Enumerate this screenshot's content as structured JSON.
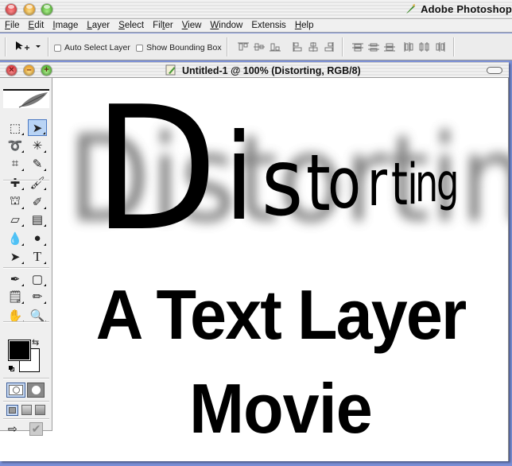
{
  "app": {
    "title": "Adobe Photoshop",
    "icon": "photoshop-feather-icon"
  },
  "menubar": {
    "items": [
      {
        "label": "File",
        "mnemonic": "F"
      },
      {
        "label": "Edit",
        "mnemonic": "E"
      },
      {
        "label": "Image",
        "mnemonic": "I"
      },
      {
        "label": "Layer",
        "mnemonic": "L"
      },
      {
        "label": "Select",
        "mnemonic": "S"
      },
      {
        "label": "Filter",
        "mnemonic": "t"
      },
      {
        "label": "View",
        "mnemonic": "V"
      },
      {
        "label": "Window",
        "mnemonic": "W"
      },
      {
        "label": "Extensis",
        "mnemonic": ""
      },
      {
        "label": "Help",
        "mnemonic": "H"
      }
    ]
  },
  "options": {
    "tool_preset_icon": "move-tool-icon",
    "auto_select_label": "Auto Select Layer",
    "auto_select_checked": false,
    "bounding_box_label": "Show Bounding Box",
    "bounding_box_checked": false,
    "align_buttons": [
      "align-top-edges",
      "align-vertical-centers",
      "align-bottom-edges",
      "align-left-edges",
      "align-horizontal-centers",
      "align-right-edges"
    ],
    "distribute_buttons": [
      "distribute-top-edges",
      "distribute-vertical-centers",
      "distribute-bottom-edges",
      "distribute-left-edges",
      "distribute-horizontal-centers",
      "distribute-right-edges"
    ]
  },
  "document": {
    "title": "Untitled-1 @ 100% (Distorting, RGB/8)"
  },
  "tools": {
    "items": [
      {
        "name": "rectangular-marquee-tool",
        "glyph": "⬚",
        "active": false
      },
      {
        "name": "move-tool",
        "glyph": "➤",
        "active": true
      },
      {
        "name": "lasso-tool",
        "glyph": "➰",
        "active": false
      },
      {
        "name": "magic-wand-tool",
        "glyph": "✳",
        "active": false
      },
      {
        "name": "crop-tool",
        "glyph": "⌗",
        "active": false
      },
      {
        "name": "slice-tool",
        "glyph": "✎",
        "active": false
      },
      {
        "name": "healing-brush-tool",
        "glyph": "✚",
        "active": false
      },
      {
        "name": "brush-tool",
        "glyph": "🖌",
        "active": false
      },
      {
        "name": "clone-stamp-tool",
        "glyph": "⛫",
        "active": false
      },
      {
        "name": "history-brush-tool",
        "glyph": "✐",
        "active": false
      },
      {
        "name": "eraser-tool",
        "glyph": "▱",
        "active": false
      },
      {
        "name": "gradient-tool",
        "glyph": "▤",
        "active": false
      },
      {
        "name": "blur-tool",
        "glyph": "💧",
        "active": false
      },
      {
        "name": "dodge-tool",
        "glyph": "●",
        "active": false
      },
      {
        "name": "path-selection-tool",
        "glyph": "➤",
        "active": false
      },
      {
        "name": "type-tool",
        "glyph": "T",
        "active": false
      },
      {
        "name": "pen-tool",
        "glyph": "✒",
        "active": false
      },
      {
        "name": "shape-tool",
        "glyph": "▢",
        "active": false
      },
      {
        "name": "notes-tool",
        "glyph": "🗒",
        "active": false
      },
      {
        "name": "eyedropper-tool",
        "glyph": "✏",
        "active": false
      },
      {
        "name": "hand-tool",
        "glyph": "✋",
        "active": false
      },
      {
        "name": "zoom-tool",
        "glyph": "🔍",
        "active": false
      }
    ],
    "foreground_color": "#000000",
    "background_color": "#ffffff",
    "swap_glyph": "⇆",
    "mode_buttons": [
      "standard-mode",
      "quick-mask-mode"
    ],
    "screen_modes": [
      "standard-screen-mode",
      "full-screen-menu-mode",
      "full-screen-mode"
    ],
    "jump_to": [
      "jump-to-imageready",
      "commit"
    ]
  },
  "canvas": {
    "distort_word": "Distorting",
    "line1": "A Text Layer",
    "line2": "Movie"
  }
}
